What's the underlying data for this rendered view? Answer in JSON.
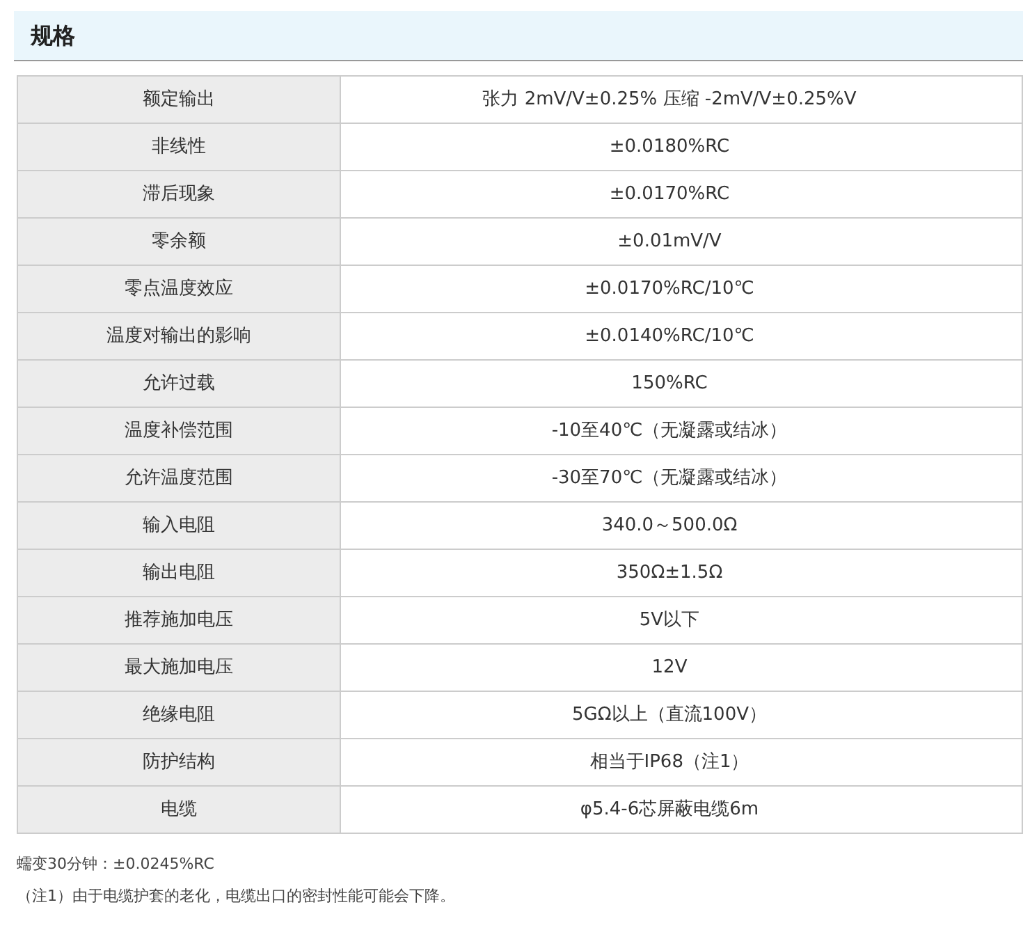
{
  "section": {
    "title": "规格"
  },
  "table": {
    "rows": [
      {
        "label": "额定输出",
        "value": "张力 2mV/V±0.25% 压缩 -2mV/V±0.25%V"
      },
      {
        "label": "非线性",
        "value": "±0.0180%RC"
      },
      {
        "label": "滞后现象",
        "value": "±0.0170%RC"
      },
      {
        "label": "零余额",
        "value": "±0.01mV/V"
      },
      {
        "label": "零点温度效应",
        "value": "±0.0170%RC/10℃"
      },
      {
        "label": "温度对输出的影响",
        "value": "±0.0140%RC/10℃"
      },
      {
        "label": "允许过载",
        "value": "150%RC"
      },
      {
        "label": "温度补偿范围",
        "value": "-10至40℃（无凝露或结冰）"
      },
      {
        "label": "允许温度范围",
        "value": "-30至70℃（无凝露或结冰）"
      },
      {
        "label": "输入电阻",
        "value": "340.0～500.0Ω"
      },
      {
        "label": "输出电阻",
        "value": "350Ω±1.5Ω"
      },
      {
        "label": "推荐施加电压",
        "value": "5V以下"
      },
      {
        "label": "最大施加电压",
        "value": "12V"
      },
      {
        "label": "绝缘电阻",
        "value": "5GΩ以上（直流100V）"
      },
      {
        "label": "防护结构",
        "value": "相当于IP68（注1）"
      },
      {
        "label": "电缆",
        "value": "φ5.4-6芯屏蔽电缆6m"
      }
    ]
  },
  "notes": [
    "蠕变30分钟：±0.0245%RC",
    "（注1）由于电缆护套的老化，电缆出口的密封性能可能会下降。"
  ]
}
